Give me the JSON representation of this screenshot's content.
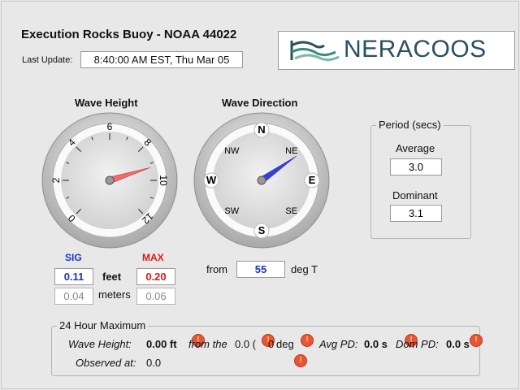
{
  "header": {
    "title": "Execution Rocks Buoy - NOAA 44022",
    "last_update_label": "Last Update:",
    "last_update_value": "8:40:00 AM EST,  Thu Mar 05",
    "logo_text": "NERACOOS"
  },
  "wave_height": {
    "title": "Wave Height",
    "ticks": [
      "0",
      "2",
      "4",
      "6",
      "8",
      "10",
      "12"
    ],
    "sig_value_ft": 0.11,
    "max_value_ft": 0.2,
    "scale_max": 12
  },
  "wave_direction": {
    "title": "Wave Direction",
    "compass": [
      "N",
      "NE",
      "E",
      "SE",
      "S",
      "SW",
      "W",
      "NW"
    ],
    "direction_deg": 55,
    "from_label": "from",
    "value": "55",
    "unit": "deg T"
  },
  "readings": {
    "sig_label": "SIG",
    "max_label": "MAX",
    "sig_feet": "0.11",
    "max_feet": "0.20",
    "feet_label": "feet",
    "sig_meters": "0.04",
    "max_meters": "0.06",
    "meters_label": "meters"
  },
  "period": {
    "title": "Period (secs)",
    "average_label": "Average",
    "average_value": "3.0",
    "dominant_label": "Dominant",
    "dominant_value": "3.1"
  },
  "max24": {
    "title": "24 Hour Maximum",
    "wave_height_label": "Wave Height:",
    "wave_height_value": "0.00 ft",
    "from_label": "from the",
    "from_value": "0.0 (",
    "from_deg_value": "0",
    "from_deg_unit": "deg",
    "avg_pd_label": "Avg PD:",
    "avg_pd_value": "0.0 s",
    "dom_pd_label": "Dom PD:",
    "dom_pd_value": "0.0 s",
    "observed_label": "Observed at:",
    "observed_value": "0.0"
  },
  "colors": {
    "sig": "#1a33c8",
    "max": "#e01818",
    "needle_wave": "#f06a6a",
    "needle_dir": "#3a3ee0",
    "logo": "#2a5061"
  }
}
